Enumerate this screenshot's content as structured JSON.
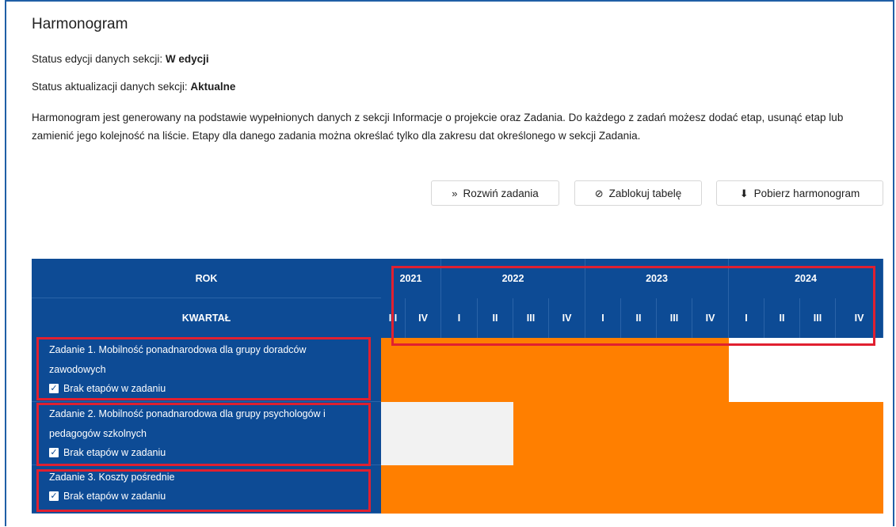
{
  "section": {
    "title": "Harmonogram",
    "edit_status_label": "Status edycji danych sekcji:",
    "edit_status_value": "W edycji",
    "update_status_label": "Status aktualizacji danych sekcji:",
    "update_status_value": "Aktualne",
    "description": "Harmonogram jest generowany na podstawie wypełnionych danych z sekcji Informacje o projekcie oraz Zadania. Do każdego z zadań możesz dodać etap, usunąć etap lub zamienić jego kolejność na liście. Etapy dla danego zadania można określać tylko dla zakresu dat określonego w sekcji Zadania."
  },
  "toolbar": {
    "expand_label": "Rozwiń zadania",
    "expand_icon": "double-chevron-down-icon",
    "lock_label": "Zablokuj tabelę",
    "lock_icon": "block-icon",
    "download_label": "Pobierz harmonogram",
    "download_icon": "download-icon"
  },
  "table": {
    "year_header": "ROK",
    "quarter_header": "KWARTAŁ",
    "years": [
      {
        "label": "2021",
        "quarters": 2
      },
      {
        "label": "2022",
        "quarters": 4
      },
      {
        "label": "2023",
        "quarters": 4
      },
      {
        "label": "2024",
        "quarters": 4
      }
    ],
    "quarters": [
      "III",
      "IV",
      "I",
      "II",
      "III",
      "IV",
      "I",
      "II",
      "III",
      "IV",
      "I",
      "II",
      "III",
      "IV"
    ],
    "tasks": [
      {
        "name": "Zadanie 1. Mobilność ponadnarodowa dla grupy doradców zawodowych",
        "checkbox_label": "Brak etapów w zadaniu",
        "checked": true,
        "active_from_quarter": 0,
        "active_to_quarter": 9
      },
      {
        "name": "Zadanie 2. Mobilność ponadnarodowa dla grupy psychologów i pedagogów szkolnych",
        "checkbox_label": "Brak etapów w zadaniu",
        "checked": true,
        "active_from_quarter": 4,
        "active_to_quarter": 13
      },
      {
        "name": "Zadanie 3. Koszty pośrednie",
        "checkbox_label": "Brak etapów w zadaniu",
        "checked": true,
        "active_from_quarter": 0,
        "active_to_quarter": 13
      }
    ]
  },
  "colors": {
    "header_blue": "#0d4b95",
    "bar_orange": "#ff7f00",
    "empty_gray": "#f2f2f2",
    "highlight_red": "#e02030"
  }
}
